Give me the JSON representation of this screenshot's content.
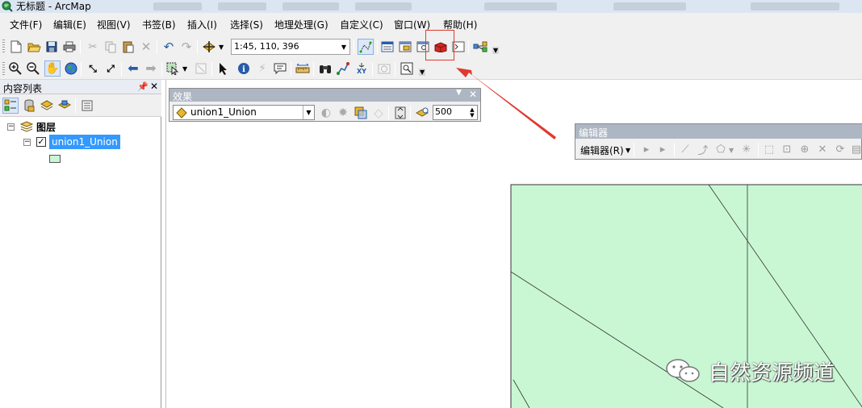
{
  "window": {
    "title": "无标题 - ArcMap"
  },
  "menu": [
    {
      "label": "文件(F)"
    },
    {
      "label": "编辑(E)"
    },
    {
      "label": "视图(V)"
    },
    {
      "label": "书签(B)"
    },
    {
      "label": "插入(I)"
    },
    {
      "label": "选择(S)"
    },
    {
      "label": "地理处理(G)"
    },
    {
      "label": "自定义(C)"
    },
    {
      "label": "窗口(W)"
    },
    {
      "label": "帮助(H)"
    }
  ],
  "standard_toolbar": {
    "scale_value": "1:45, 110, 396"
  },
  "toc": {
    "title": "内容列表",
    "root_label": "图层",
    "layer_label": "union1_Union",
    "layer_checked": true,
    "legend_color": "#c9f7d4"
  },
  "effects_toolbar": {
    "title": "效果",
    "layer_value": "union1_Union",
    "transparency_value": "500"
  },
  "editor_toolbar": {
    "title": "编辑器",
    "menu_label": "编辑器(R)"
  },
  "map": {
    "polygon_fill": "#c9f7d4",
    "line_color": "#333333"
  },
  "annotation": {
    "highlight_color": "#e03a30"
  },
  "watermark": {
    "text": "自然资源频道"
  }
}
